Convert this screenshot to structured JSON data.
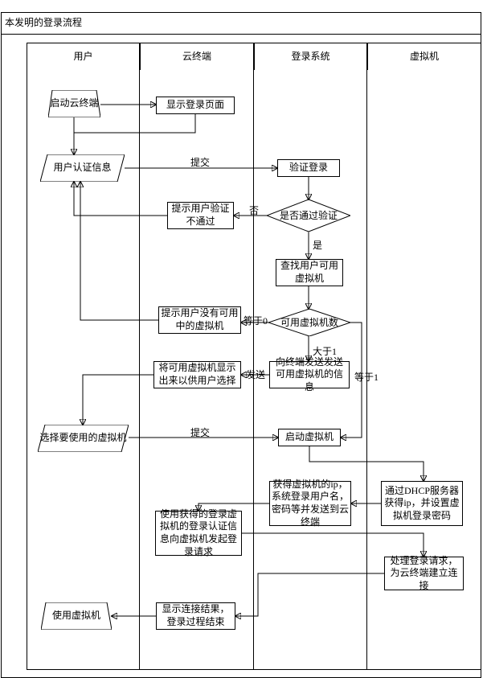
{
  "title": "本发明的登录流程",
  "lanes": {
    "l1": "用户",
    "l2": "云终端",
    "l3": "登录系统",
    "l4": "虚拟机"
  },
  "nodes": {
    "start": "启动云终端",
    "show_login": "显示登录页面",
    "auth_info": "用户认证信息",
    "verify": "验证登录",
    "pass_q": "是否通过验证",
    "fail_tip": "提示用户验证不通过",
    "find_vm": "查找用户可用虚拟机",
    "vm_count": "可用虚拟机数",
    "no_vm": "提示用户没有可用中的虚拟机",
    "send_vm": "向终端发送发送可用虚拟机的信息",
    "show_vm": "将可用虚拟机显示出来以供用户选择",
    "choose": "选择要使用的虚拟机",
    "start_vm": "启动虚拟机",
    "dhcp": "通过DHCP服务器获得ip，并设置虚拟机登录密码",
    "get_ip": "获得虚拟机的ip，系统登录用户名，密码等并发送到云终端",
    "login_req": "使用获得的登录虚拟机的登录认证信息向虚拟机发起登录请求",
    "handle": "处理登录请求，为云终端建立连接",
    "result": "显示连接结果，登录过程结束",
    "use": "使用虚拟机"
  },
  "edges": {
    "submit1": "提交",
    "no": "否",
    "yes": "是",
    "eq0": "等于0",
    "gt1": "大于1",
    "send": "发送",
    "eq1": "等于1",
    "submit2": "提交"
  }
}
